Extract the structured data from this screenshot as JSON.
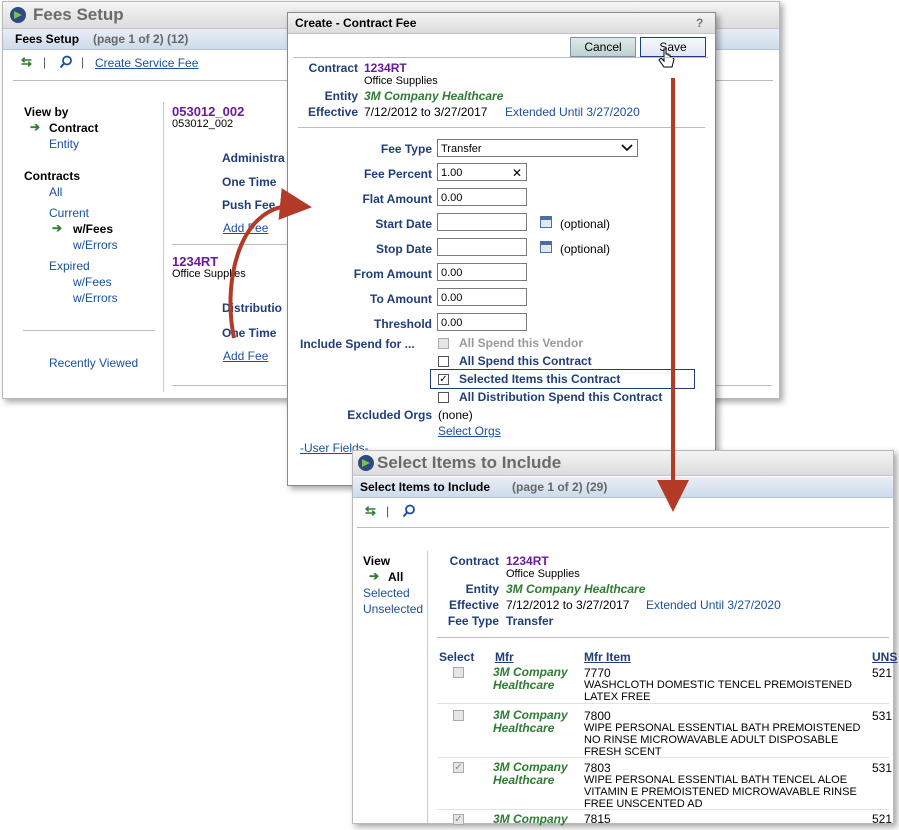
{
  "fees_setup": {
    "title": "Fees Setup",
    "subtitle": "Fees Setup",
    "page_info": "(page 1 of 2) (12)",
    "toolbar": {
      "separator": "|",
      "create_service_fee": "Create Service Fee"
    },
    "view_by": {
      "heading": "View by",
      "contract": "Contract",
      "entity": "Entity",
      "contracts_heading": "Contracts",
      "all": "All",
      "current": "Current",
      "w_fees": "w/Fees",
      "w_errors": "w/Errors",
      "expired": "Expired",
      "exp_w_fees": "w/Fees",
      "exp_w_errors": "w/Errors",
      "recently_viewed": "Recently Viewed"
    },
    "records": [
      {
        "id": "053012_002",
        "sub": "053012_002",
        "rows": [
          "Administra",
          "One Time",
          "Push Fee"
        ],
        "add": "Add Fee"
      },
      {
        "id": "1234RT",
        "sub": "Office Supplies",
        "rows": [
          "Distributio",
          "One Time"
        ],
        "add": "Add Fee"
      }
    ]
  },
  "create_fee": {
    "title": "Create - Contract Fee",
    "help": "?",
    "cancel": "Cancel",
    "save": "Save",
    "contract_label": "Contract",
    "contract_id": "1234RT",
    "contract_name": "Office Supplies",
    "entity_label": "Entity",
    "entity": "3M Company Healthcare",
    "effective_label": "Effective",
    "effective": "7/12/2012 to 3/27/2017",
    "extended": "Extended Until 3/27/2020",
    "fee_type_label": "Fee Type",
    "fee_type": "Transfer",
    "fee_percent_label": "Fee Percent",
    "fee_percent": "1.00",
    "clear": "✕",
    "flat_amount_label": "Flat Amount",
    "flat_amount": "0.00",
    "start_date_label": "Start Date",
    "stop_date_label": "Stop Date",
    "optional": "(optional)",
    "from_amount_label": "From Amount",
    "from_amount": "0.00",
    "to_amount_label": "To Amount",
    "to_amount": "0.00",
    "threshold_label": "Threshold",
    "threshold": "0.00",
    "include_label": "Include Spend for ...",
    "opt_vendor": "All Spend this Vendor",
    "opt_contract": "All Spend this Contract",
    "opt_selected": "Selected Items this Contract",
    "opt_distribution": "All Distribution Spend this Contract",
    "check": "✓",
    "excluded_label": "Excluded Orgs",
    "excluded": "(none)",
    "select_orgs": "Select Orgs",
    "user_fields": "-User Fields-"
  },
  "select_items": {
    "title": "Select Items to Include",
    "subtitle": "Select Items to Include",
    "page_info": "(page 1 of 2) (29)",
    "separator": "|",
    "view_heading": "View",
    "view_all": "All",
    "view_selected": "Selected",
    "view_unselected": "Unselected",
    "contract_label": "Contract",
    "contract_id": "1234RT",
    "contract_name": "Office Supplies",
    "entity_label": "Entity",
    "entity": "3M Company Healthcare",
    "effective_label": "Effective",
    "effective": "7/12/2012 to 3/27/2017",
    "extended": "Extended Until 3/27/2020",
    "fee_type_label": "Fee Type",
    "fee_type": "Transfer",
    "columns": {
      "select": "Select",
      "mfr": "Mfr",
      "mfr_item": "Mfr Item",
      "uns": "UNS"
    },
    "rows": [
      {
        "checked": false,
        "mfr": "3M Company Healthcare",
        "item": "7770",
        "desc": "WASHCLOTH DOMESTIC TENCEL PREMOISTENED LATEX FREE",
        "uns": "521"
      },
      {
        "checked": false,
        "mfr": "3M Company Healthcare",
        "item": "7800",
        "desc": "WIPE PERSONAL ESSENTIAL BATH PREMOISTENED NO RINSE MICROWAVABLE ADULT DISPOSABLE FRESH SCENT",
        "uns": "531"
      },
      {
        "checked": true,
        "mfr": "3M Company Healthcare",
        "item": "7803",
        "desc": "WIPE PERSONAL ESSENTIAL BATH TENCEL ALOE VITAMIN E PREMOISTENED MICROWAVABLE RINSE FREE UNSCENTED AD",
        "uns": "531"
      },
      {
        "checked": true,
        "mfr": "3M Company",
        "item": "7815",
        "desc": "",
        "uns": "521"
      }
    ]
  }
}
